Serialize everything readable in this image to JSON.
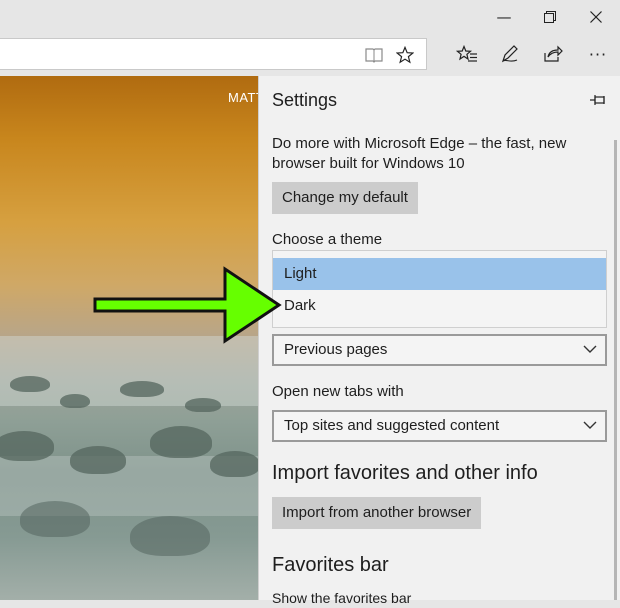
{
  "window": {
    "minimize_glyph": "—",
    "restore_glyph": "❐",
    "close_glyph": "✕"
  },
  "toolbar": {
    "reading_view_icon": "book-icon",
    "favorite_icon": "star-icon",
    "hub_icon": "favorites-hub-icon",
    "notes_icon": "pen-icon",
    "share_icon": "share-icon",
    "more_label": "···"
  },
  "page": {
    "username": "MATT"
  },
  "settings": {
    "title": "Settings",
    "promo_text": "Do more with Microsoft Edge – the fast, new browser built for Windows 10",
    "change_default_label": "Change my default",
    "theme_label": "Choose a theme",
    "theme_options": [
      "Light",
      "Dark"
    ],
    "theme_selected": "Light",
    "open_with_value": "Previous pages",
    "new_tabs_label": "Open new tabs with",
    "new_tabs_value": "Top sites and suggested content",
    "import_heading": "Import favorites and other info",
    "import_button_label": "Import from another browser",
    "favorites_bar_heading": "Favorites bar",
    "show_favorites_bar_label": "Show the favorites bar"
  },
  "colors": {
    "selected_option": "#99c2ea",
    "annotation_arrow": "#66ff00",
    "button_bg": "#cccccc"
  }
}
